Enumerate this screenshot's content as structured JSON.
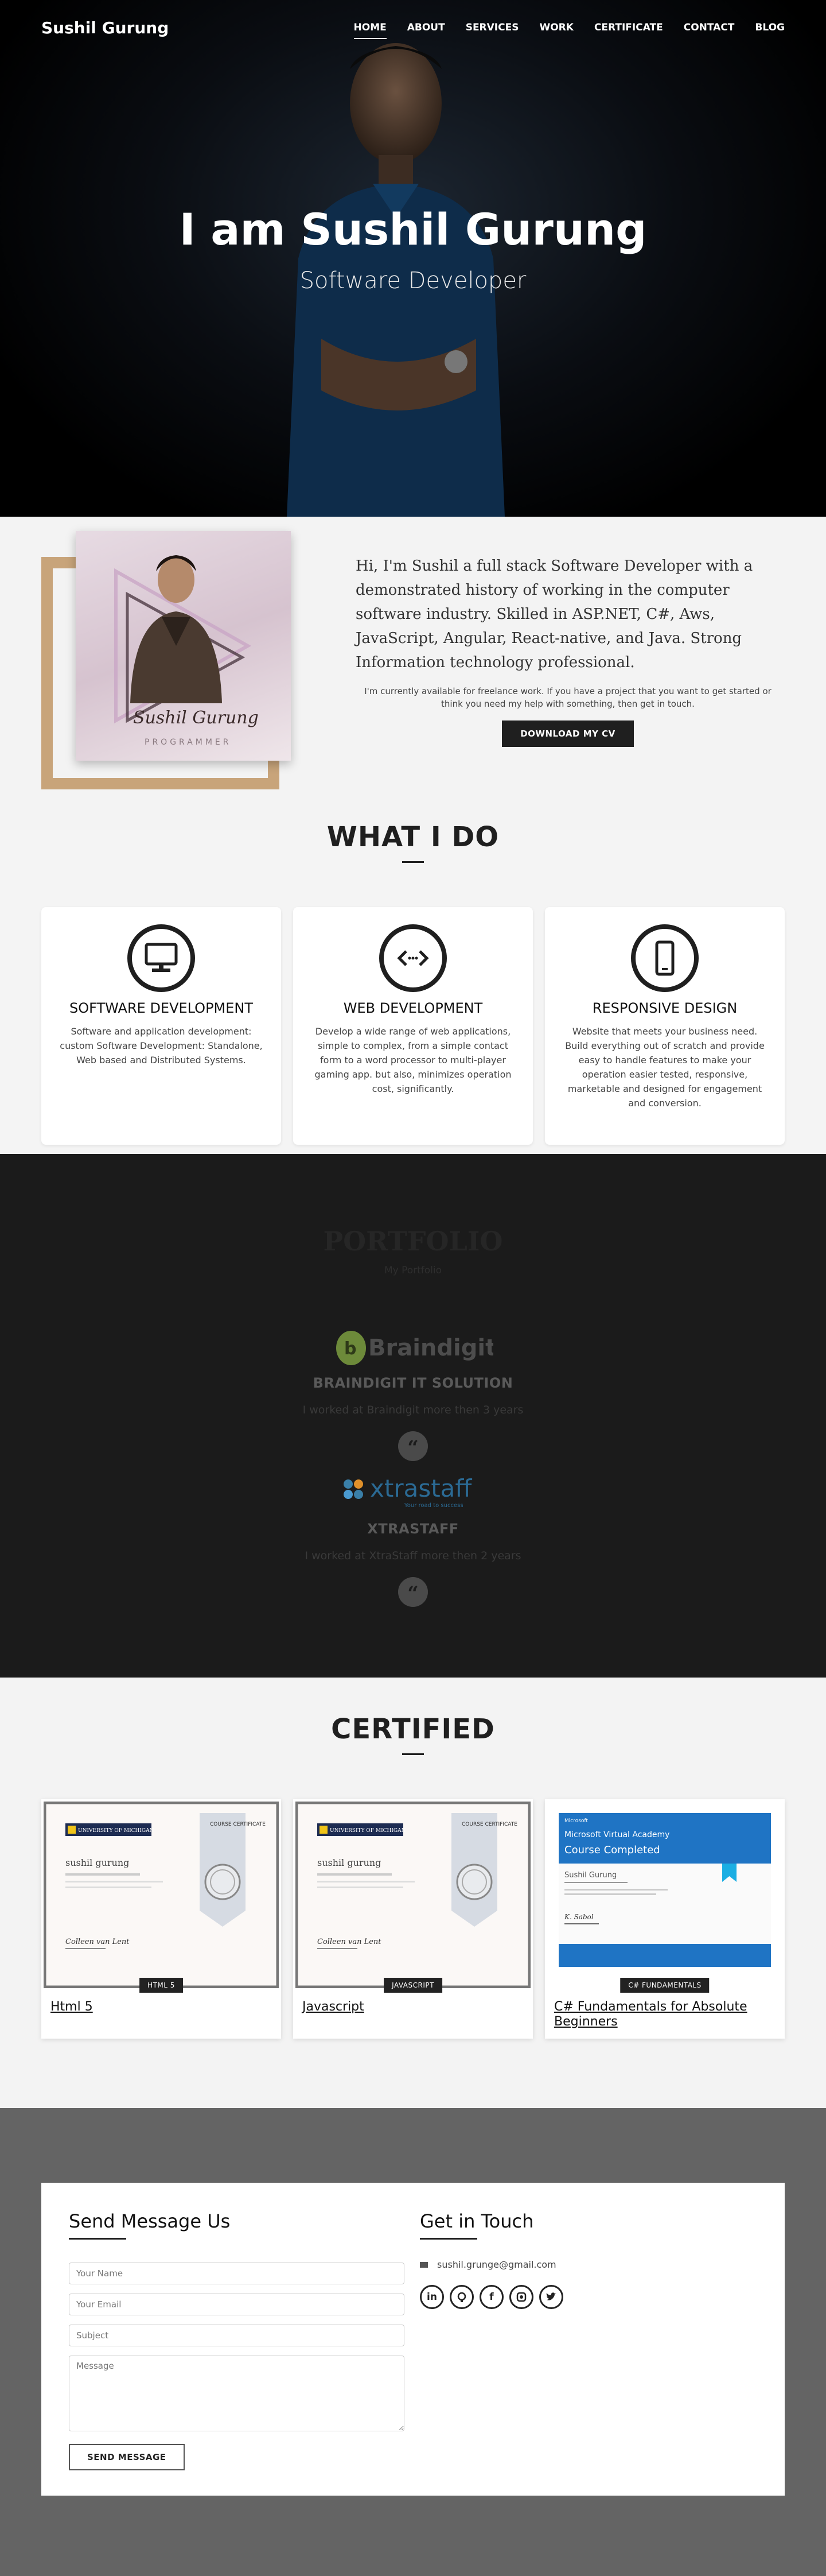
{
  "nav": {
    "brand": "Sushil Gurung",
    "links": [
      "HOME",
      "ABOUT",
      "SERVICES",
      "WORK",
      "CERTIFICATE",
      "CONTACT",
      "BLOG"
    ]
  },
  "hero": {
    "title": "I am Sushil Gurung",
    "subtitle": "Software Developer"
  },
  "about": {
    "photo_text": "Sushil Gurung",
    "photo_caption": "PROGRAMMER",
    "lead": "Hi, I'm Sushil a full stack Software Developer with a demonstrated history of working in the computer software industry. Skilled in ASP.NET, C#, Aws, JavaScript, Angular, React-native, and Java. Strong Information technology professional.",
    "small": "I'm currently available for freelance work. If you have a project that you want to get started or think you need my help with something, then get in touch.",
    "cv_button": "DOWNLOAD MY CV"
  },
  "services": {
    "title": "WHAT I DO",
    "items": [
      {
        "title": "SOFTWARE DEVELOPMENT",
        "desc": "Software and application development: custom Software Development: Standalone, Web based and Distributed Systems.",
        "icon": "monitor-icon"
      },
      {
        "title": "WEB DEVELOPMENT",
        "desc": "Develop a wide range of web applications, simple to complex, from a simple contact form to a word processor to multi-player gaming app. but also, minimizes operation cost, significantly.",
        "icon": "code-icon"
      },
      {
        "title": "RESPONSIVE DESIGN",
        "desc": "Website that meets your business need. Build everything out of scratch and provide easy to handle features to make your operation easier tested, responsive, marketable and designed for engagement and conversion.",
        "icon": "mobile-icon"
      }
    ]
  },
  "portfolio": {
    "title": "PORTFOLIO",
    "subtitle": "My Portfolio",
    "companies": [
      {
        "logo_text": "Braindigit",
        "name": "BRAINDIGIT IT SOLUTION",
        "desc": "I worked at Braindigit more then 3 years"
      },
      {
        "logo_text": "xtrastaff",
        "logo_tagline": "Your road to success",
        "name": "XTRASTAFF",
        "desc": "I worked at XtraStaff more then 2 years"
      }
    ]
  },
  "certified": {
    "title": "CERTIFIED",
    "items": [
      {
        "tag": "HTML 5",
        "link": "Html 5",
        "kind": "michigan"
      },
      {
        "tag": "JAVASCRIPT",
        "link": "Javascript",
        "kind": "michigan"
      },
      {
        "tag": "C# FUNDAMENTALS",
        "link": "C# Fundamentals for Absolute Beginners",
        "kind": "microsoft"
      }
    ],
    "michigan": {
      "university": "UNIVERSITY OF MICHIGAN",
      "ribbon": "COURSE CERTIFICATE",
      "name": "sushil gurung"
    },
    "microsoft": {
      "brand": "Microsoft",
      "academy": "Microsoft Virtual Academy",
      "status": "Course Completed",
      "name": "Sushil Gurung"
    }
  },
  "contact": {
    "send_title": "Send Message Us",
    "touch_title": "Get in Touch",
    "name_placeholder": "Your Name",
    "email_placeholder": "Your Email",
    "subject_placeholder": "Subject",
    "message_placeholder": "Message",
    "send_button": "SEND MESSAGE",
    "email": "sushil.grunge@gmail.com",
    "socials": [
      "linkedin-icon",
      "github-icon",
      "facebook-icon",
      "instagram-icon",
      "twitter-icon"
    ]
  }
}
